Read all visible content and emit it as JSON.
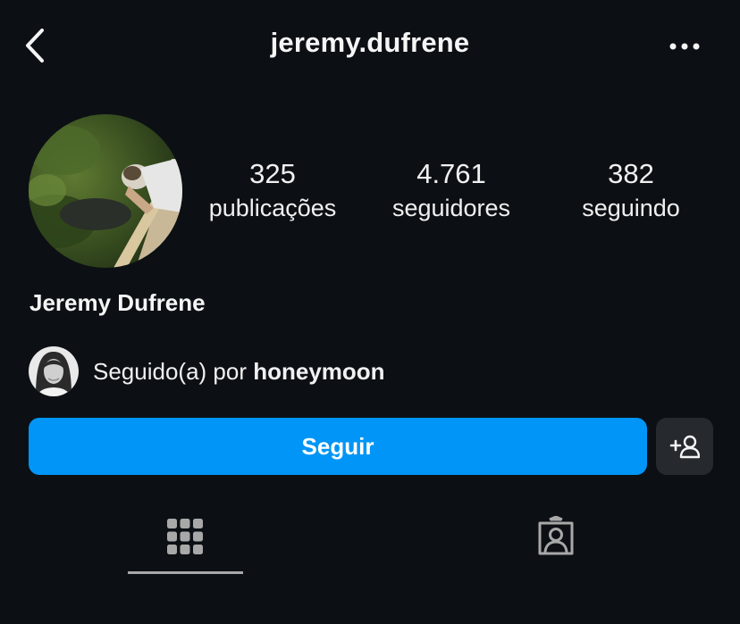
{
  "header": {
    "username": "jeremy.dufrene",
    "back_icon": "chevron-left-icon",
    "more_icon": "more-horizontal-icon"
  },
  "profile": {
    "display_name": "Jeremy Dufrene",
    "stats": {
      "posts": {
        "value": "325",
        "label": "publicações"
      },
      "followers": {
        "value": "4.761",
        "label": "seguidores"
      },
      "following": {
        "value": "382",
        "label": "seguindo"
      }
    }
  },
  "followed_by": {
    "prefix": "Seguido(a) por",
    "user": "honeymoon"
  },
  "actions": {
    "follow_label": "Seguir",
    "suggest_icon": "add-person-icon"
  },
  "tabs": [
    {
      "name": "grid",
      "icon": "grid-icon",
      "active": true
    },
    {
      "name": "tagged",
      "icon": "tagged-user-icon",
      "active": false
    }
  ],
  "colors": {
    "background": "#0c1014",
    "primary": "#0095f6",
    "secondary_button": "#262a2f"
  }
}
